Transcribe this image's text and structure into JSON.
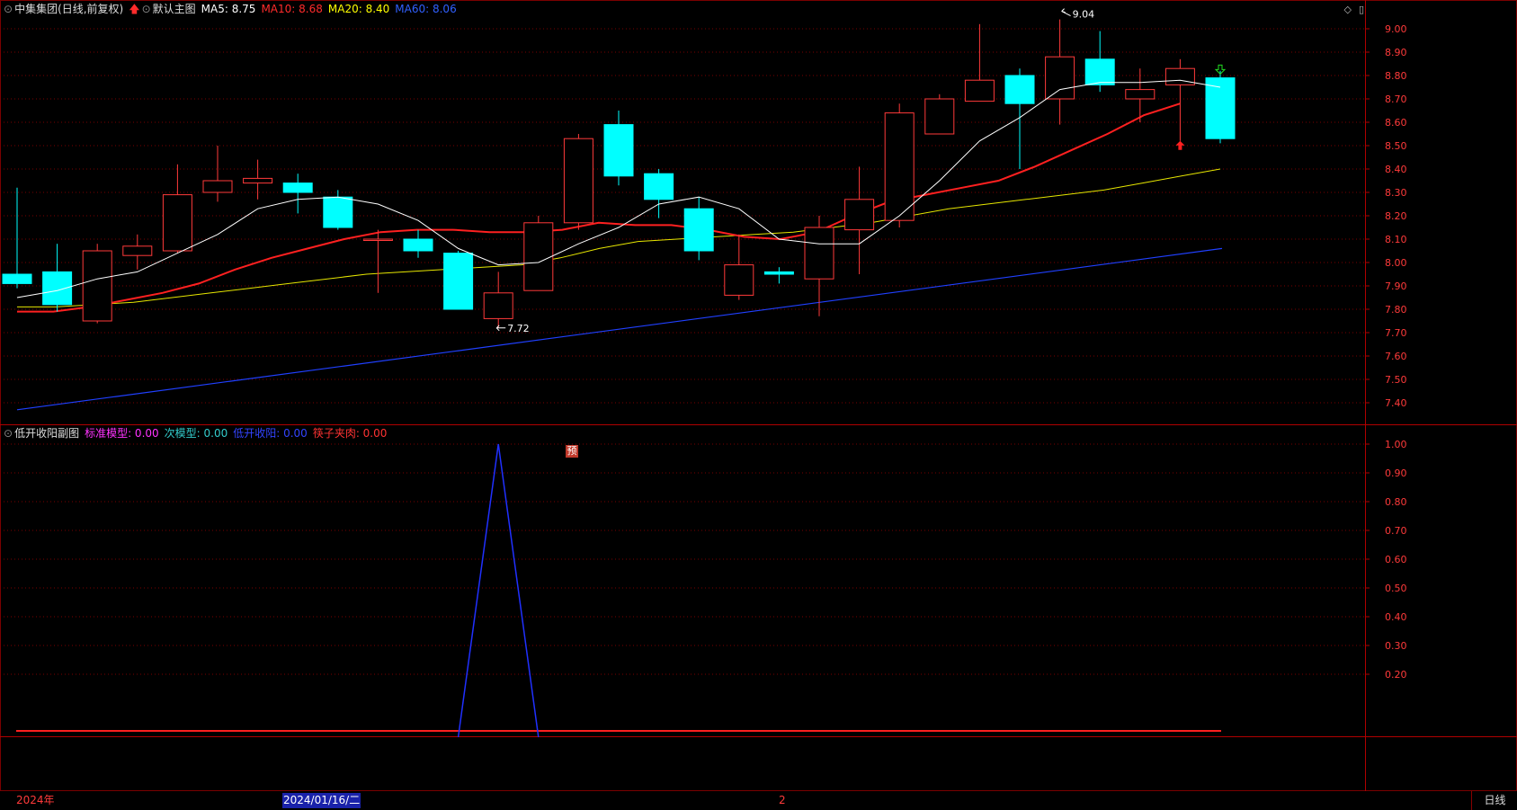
{
  "main": {
    "stock_name": "中集集团(日线,前复权)",
    "indicator_name": "默认主图",
    "ma_labels": [
      {
        "text": "MA5: 8.75",
        "color": "#ffffff"
      },
      {
        "text": "MA10: 8.68",
        "color": "#ff2b2b"
      },
      {
        "text": "MA20: 8.40",
        "color": "#ffff00"
      },
      {
        "text": "MA60: 8.06",
        "color": "#3060ff"
      }
    ],
    "high_annotation": "9.04",
    "low_annotation": "7.72",
    "prediction_badge": "预",
    "y_ticks": [
      "9.00",
      "8.90",
      "8.80",
      "8.70",
      "8.60",
      "8.50",
      "8.40",
      "8.30",
      "8.20",
      "8.10",
      "8.00",
      "7.90",
      "7.80",
      "7.70",
      "7.60",
      "7.50",
      "7.40"
    ]
  },
  "sub": {
    "indicator_name": "低开收阳副图",
    "labels": [
      {
        "text": "标准模型: 0.00",
        "color": "#ff33ff"
      },
      {
        "text": "次模型: 0.00",
        "color": "#33cccc"
      },
      {
        "text": "低开收阳: 0.00",
        "color": "#3344ff"
      },
      {
        "text": "筷子夹肉: 0.00",
        "color": "#ff3333"
      }
    ],
    "y_ticks": [
      "1.00",
      "0.90",
      "0.80",
      "0.70",
      "0.60",
      "0.50",
      "0.40",
      "0.30",
      "0.20"
    ]
  },
  "bottom": {
    "year_label": "2024年",
    "cursor_date": "2024/01/16/二",
    "month_marker": "2",
    "period_button": "日线"
  },
  "colors": {
    "up": "#ff3a3a",
    "down": "#00ffff",
    "grid": "#7a0000"
  },
  "chart_data": {
    "type": "candlestick",
    "candles": [
      {
        "o": 7.95,
        "c": 7.91,
        "h": 8.32,
        "l": 7.89
      },
      {
        "o": 7.96,
        "c": 7.82,
        "h": 8.08,
        "l": 7.79
      },
      {
        "o": 7.75,
        "c": 8.05,
        "h": 8.08,
        "l": 7.74
      },
      {
        "o": 8.03,
        "c": 8.07,
        "h": 8.12,
        "l": 7.97
      },
      {
        "o": 8.05,
        "c": 8.29,
        "h": 8.42,
        "l": 8.04
      },
      {
        "o": 8.3,
        "c": 8.35,
        "h": 8.5,
        "l": 8.26
      },
      {
        "o": 8.34,
        "c": 8.36,
        "h": 8.44,
        "l": 8.27
      },
      {
        "o": 8.34,
        "c": 8.3,
        "h": 8.38,
        "l": 8.21
      },
      {
        "o": 8.28,
        "c": 8.15,
        "h": 8.31,
        "l": 8.14
      },
      {
        "o": 8.1,
        "c": 8.1,
        "h": 8.14,
        "l": 7.87
      },
      {
        "o": 8.1,
        "c": 8.05,
        "h": 8.14,
        "l": 8.02
      },
      {
        "o": 8.04,
        "c": 7.8,
        "h": 8.05,
        "l": 7.8
      },
      {
        "o": 7.76,
        "c": 7.87,
        "h": 7.96,
        "l": 7.72
      },
      {
        "o": 7.88,
        "c": 8.17,
        "h": 8.2,
        "l": 7.88
      },
      {
        "o": 8.17,
        "c": 8.53,
        "h": 8.55,
        "l": 8.14
      },
      {
        "o": 8.59,
        "c": 8.37,
        "h": 8.65,
        "l": 8.33
      },
      {
        "o": 8.38,
        "c": 8.27,
        "h": 8.4,
        "l": 8.19
      },
      {
        "o": 8.23,
        "c": 8.05,
        "h": 8.28,
        "l": 8.01
      },
      {
        "o": 7.86,
        "c": 7.99,
        "h": 8.12,
        "l": 7.84
      },
      {
        "o": 7.96,
        "c": 7.95,
        "h": 7.98,
        "l": 7.91
      },
      {
        "o": 7.93,
        "c": 8.15,
        "h": 8.2,
        "l": 7.77
      },
      {
        "o": 8.14,
        "c": 8.27,
        "h": 8.41,
        "l": 7.95
      },
      {
        "o": 8.18,
        "c": 8.64,
        "h": 8.68,
        "l": 8.15
      },
      {
        "o": 8.55,
        "c": 8.7,
        "h": 8.72,
        "l": 8.55
      },
      {
        "o": 8.69,
        "c": 8.78,
        "h": 9.02,
        "l": 8.69
      },
      {
        "o": 8.8,
        "c": 8.68,
        "h": 8.83,
        "l": 8.4
      },
      {
        "o": 8.7,
        "c": 8.88,
        "h": 9.04,
        "l": 8.59
      },
      {
        "o": 8.87,
        "c": 8.76,
        "h": 8.99,
        "l": 8.73
      },
      {
        "o": 8.7,
        "c": 8.74,
        "h": 8.83,
        "l": 8.6
      },
      {
        "o": 8.76,
        "c": 8.83,
        "h": 8.87,
        "l": 8.52
      },
      {
        "o": 8.79,
        "c": 8.53,
        "h": 8.82,
        "l": 8.51
      }
    ],
    "ma5": [
      7.85,
      7.88,
      7.93,
      7.96,
      8.04,
      8.12,
      8.23,
      8.27,
      8.28,
      8.25,
      8.18,
      8.06,
      7.99,
      8.0,
      8.08,
      8.15,
      8.25,
      8.28,
      8.23,
      8.1,
      8.08,
      8.08,
      8.2,
      8.35,
      8.52,
      8.62,
      8.74,
      8.77,
      8.77,
      8.78,
      8.75
    ],
    "ma10": [
      7.79,
      7.79,
      7.81,
      7.84,
      7.87,
      7.91,
      7.97,
      8.02,
      8.06,
      8.1,
      8.13,
      8.14,
      8.14,
      8.13,
      8.13,
      8.14,
      8.17,
      8.16,
      8.16,
      8.14,
      8.11,
      8.1,
      8.13,
      8.2,
      8.26,
      8.29,
      8.32,
      8.35,
      8.41,
      8.48,
      8.55,
      8.63,
      8.68
    ],
    "ma20": [
      7.81,
      7.81,
      7.82,
      7.83,
      7.85,
      7.87,
      7.89,
      7.91,
      7.93,
      7.95,
      7.96,
      7.97,
      7.98,
      7.99,
      8.02,
      8.06,
      8.09,
      8.1,
      8.11,
      8.12,
      8.13,
      8.15,
      8.17,
      8.2,
      8.23,
      8.25,
      8.27,
      8.29,
      8.31,
      8.34,
      8.37,
      8.4
    ],
    "ma60_start": 7.37,
    "ma60_end": 8.06,
    "sub_series": {
      "name": "低开收阳",
      "values": [
        0,
        0,
        0,
        0,
        0,
        0,
        0,
        0,
        0,
        0,
        0,
        0,
        1,
        0,
        0,
        0,
        0,
        0,
        0,
        0,
        0,
        0,
        0,
        0,
        0,
        0,
        0,
        0,
        0,
        0,
        0
      ]
    },
    "ylim_main": [
      7.35,
      9.04
    ],
    "ylim_sub": [
      0,
      1.0
    ]
  }
}
